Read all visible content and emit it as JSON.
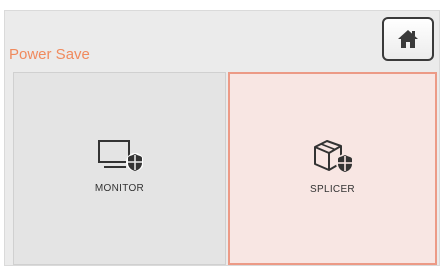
{
  "header": {
    "title": "Power Save",
    "home_icon": "home-icon"
  },
  "options": [
    {
      "label": "MONITOR",
      "icon": "monitor-icon",
      "badge_icon": "shield-icon",
      "selected": false
    },
    {
      "label": "SPLICER",
      "icon": "box-icon",
      "badge_icon": "shield-icon",
      "selected": true
    }
  ],
  "colors": {
    "accent": "#f08a5d",
    "selected_border": "#ec9a86",
    "selected_fill": "#f8e6e3",
    "panel_fill": "#e4e4e4"
  }
}
